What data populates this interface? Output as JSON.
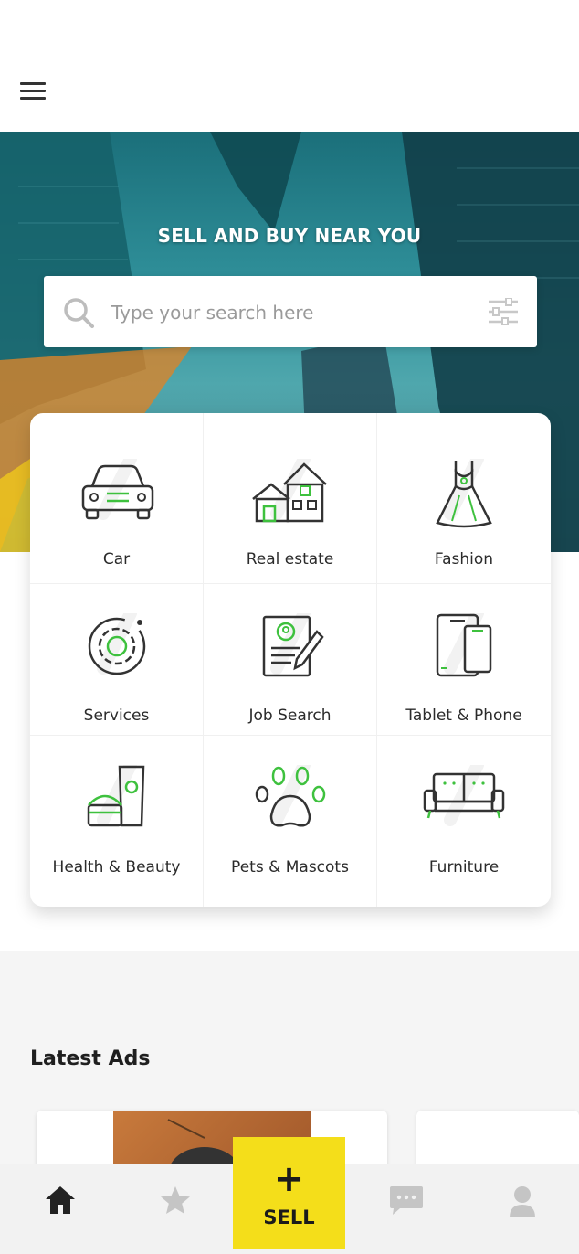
{
  "header": {
    "menu_icon": "hamburger-menu-icon"
  },
  "hero": {
    "title": "SELL AND BUY NEAR YOU",
    "search_placeholder": "Type your search here",
    "search_icon": "search-icon",
    "filter_icon": "sliders-filter-icon"
  },
  "categories": [
    {
      "label": "Car",
      "icon": "car-icon"
    },
    {
      "label": "Real estate",
      "icon": "house-icon"
    },
    {
      "label": "Fashion",
      "icon": "dress-icon"
    },
    {
      "label": "Services",
      "icon": "gear-icon"
    },
    {
      "label": "Job Search",
      "icon": "resume-icon"
    },
    {
      "label": "Tablet & Phone",
      "icon": "devices-icon"
    },
    {
      "label": "Health & Beauty",
      "icon": "cosmetics-icon"
    },
    {
      "label": "Pets & Mascots",
      "icon": "paw-icon"
    },
    {
      "label": "Furniture",
      "icon": "sofa-icon"
    }
  ],
  "latest": {
    "title": "Latest Ads"
  },
  "bottom_nav": {
    "items": [
      {
        "icon": "home-icon",
        "active": true
      },
      {
        "icon": "star-icon",
        "active": false
      },
      {
        "icon": "chat-icon",
        "active": false
      },
      {
        "icon": "user-icon",
        "active": false
      }
    ],
    "sell": {
      "plus": "+",
      "label": "SELL"
    }
  },
  "colors": {
    "accent": "#f4de1a",
    "icon_green": "#3ec13e",
    "hero_teal": "#2f8f99"
  }
}
